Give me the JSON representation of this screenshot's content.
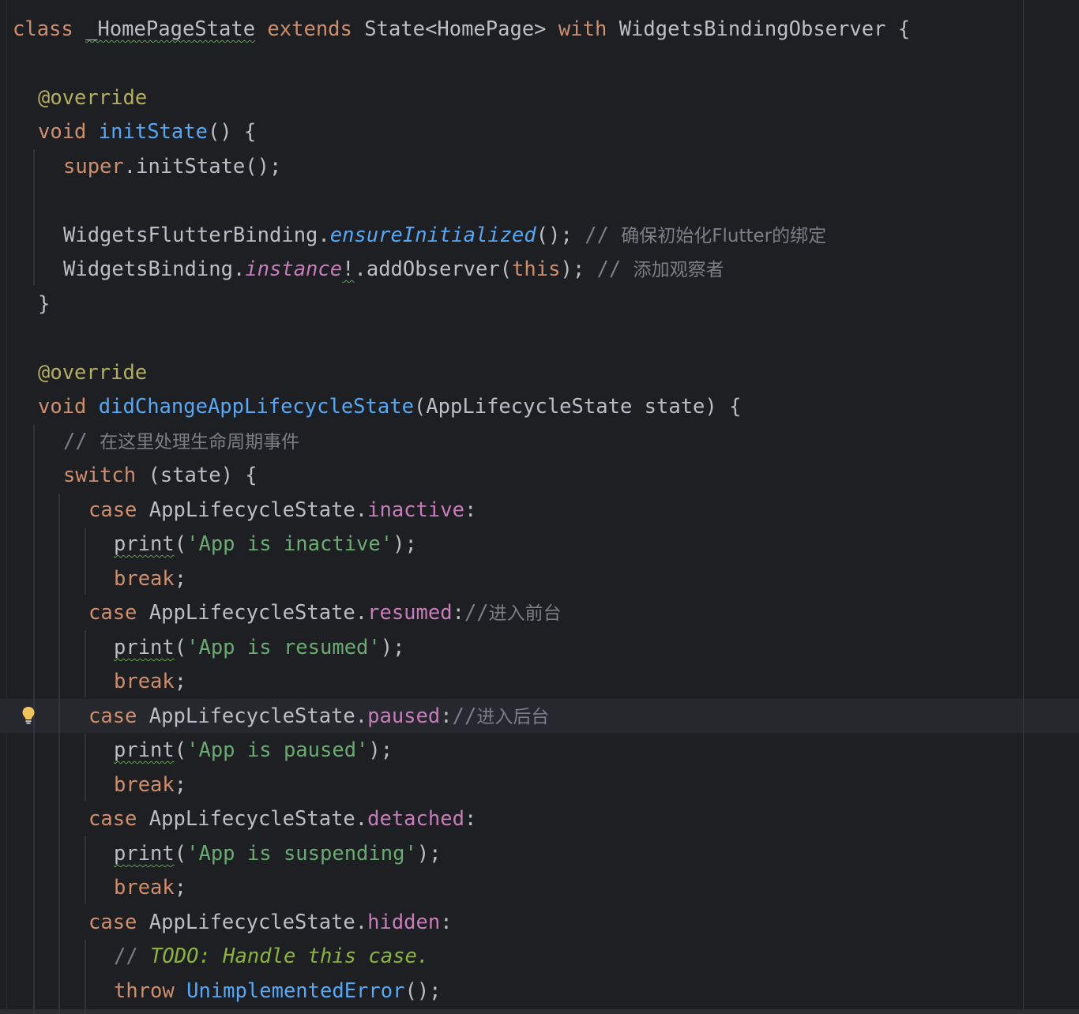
{
  "editor": {
    "language": "dart",
    "colors": {
      "background": "#1e1f22",
      "current_line": "#26282e",
      "keyword": "#cf8e6d",
      "function": "#56a8f5",
      "annotation": "#b3ae60",
      "string": "#6aab73",
      "comment": "#7a7e85",
      "todo": "#8bb33d",
      "property": "#c77dbb",
      "text": "#bcbec4"
    },
    "intention_bulb_icon": "lightbulb-icon"
  },
  "code": {
    "l1": {
      "kw_class": "class",
      "class_name": "_HomePageState",
      "kw_extends": "extends",
      "base": "State<HomePage>",
      "kw_with": "with",
      "mixin": "WidgetsBindingObserver",
      "brace": "{"
    },
    "l3": {
      "ann": "@override"
    },
    "l4": {
      "kw_void": "void",
      "fn": "initState",
      "rest": "() {"
    },
    "l5": {
      "kw_super": "super",
      "rest": ".initState();"
    },
    "l7": {
      "cls": "WidgetsFlutterBinding",
      "dot": ".",
      "method": "ensureInitialized",
      "rest": "();",
      "cmt_slash": "// ",
      "cmt_text": "确保初始化Flutter的绑定"
    },
    "l8": {
      "cls": "WidgetsBinding",
      "dot": ".",
      "prop": "instance",
      "bang": "!",
      "call": ".addObserver(",
      "kw_this": "this",
      "rest": ");",
      "cmt_slash": "// ",
      "cmt_text": "添加观察者"
    },
    "l9": {
      "brace": "}"
    },
    "l11": {
      "ann": "@override"
    },
    "l12": {
      "kw_void": "void",
      "fn": "didChangeAppLifecycleState",
      "rest": "(AppLifecycleState state) {"
    },
    "l13": {
      "cmt_slash": "// ",
      "cmt_text": "在这里处理生命周期事件"
    },
    "l14": {
      "kw_switch": "switch",
      "rest": " (state) {"
    },
    "l15": {
      "kw_case": "case",
      "cls": "AppLifecycleState.",
      "prop": "inactive",
      "rest": ":"
    },
    "l16": {
      "fn": "print",
      "open": "(",
      "str": "'App is inactive'",
      "close": ");"
    },
    "l17": {
      "kw_break": "break",
      "semi": ";"
    },
    "l18": {
      "kw_case": "case",
      "cls": "AppLifecycleState.",
      "prop": "resumed",
      "rest": ":",
      "cmt_slash": "//",
      "cmt_text": "进入前台"
    },
    "l19": {
      "fn": "print",
      "open": "(",
      "str": "'App is resumed'",
      "close": ");"
    },
    "l20": {
      "kw_break": "break",
      "semi": ";"
    },
    "l21": {
      "kw_case": "case",
      "cls": "AppLifecycleState.",
      "prop": "paused",
      "rest": ":",
      "cmt_slash": "//",
      "cmt_text": "进入后台"
    },
    "l22": {
      "fn": "print",
      "open": "(",
      "str": "'App is paused'",
      "close": ");"
    },
    "l23": {
      "kw_break": "break",
      "semi": ";"
    },
    "l24": {
      "kw_case": "case",
      "cls": "AppLifecycleState.",
      "prop": "detached",
      "rest": ":"
    },
    "l25": {
      "fn": "print",
      "open": "(",
      "str": "'App is suspending'",
      "close": ");"
    },
    "l26": {
      "kw_break": "break",
      "semi": ";"
    },
    "l27": {
      "kw_case": "case",
      "cls": "AppLifecycleState.",
      "prop": "hidden",
      "rest": ":"
    },
    "l28": {
      "cmt_slash": "// ",
      "todo": "TODO: Handle this case."
    },
    "l29": {
      "kw_throw": "throw",
      "fn": "UnimplementedError",
      "rest": "();"
    }
  }
}
